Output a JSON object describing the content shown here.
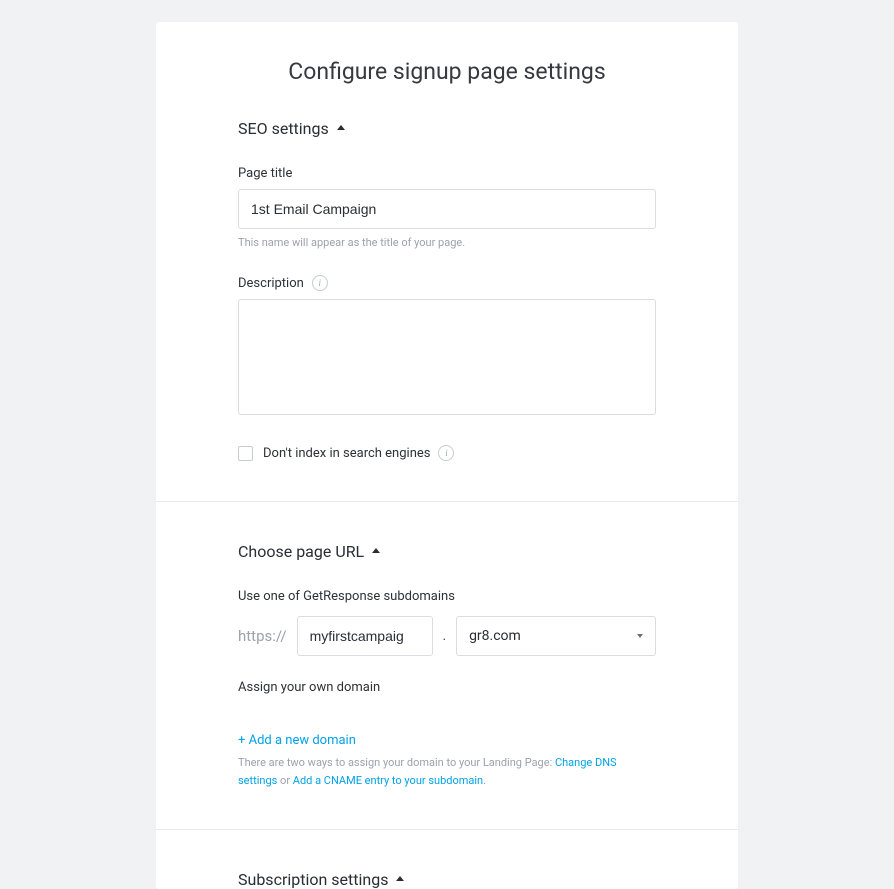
{
  "page": {
    "title": "Configure signup page settings"
  },
  "seo": {
    "header": "SEO settings",
    "page_title_label": "Page title",
    "page_title_value": "1st Email Campaign",
    "page_title_hint": "This name will appear as the title of your page.",
    "description_label": "Description",
    "description_value": "",
    "noindex_label": "Don't index in search engines"
  },
  "url": {
    "header": "Choose page URL",
    "subdomain_label": "Use one of GetResponse subdomains",
    "protocol": "https://",
    "subdomain_value": "myfirstcampaig",
    "dot": ".",
    "domain_value": "gr8.com",
    "own_domain_label": "Assign your own domain",
    "add_domain_link": "+ Add a new domain",
    "help_text_prefix": "There are two ways to assign your domain to your Landing Page: ",
    "help_link_dns": "Change DNS settings",
    "help_text_or": " or ",
    "help_link_cname": "Add a CNAME entry to your subdomain",
    "help_text_suffix": "."
  },
  "subscription": {
    "header": "Subscription settings"
  },
  "icons": {
    "info": "i"
  }
}
